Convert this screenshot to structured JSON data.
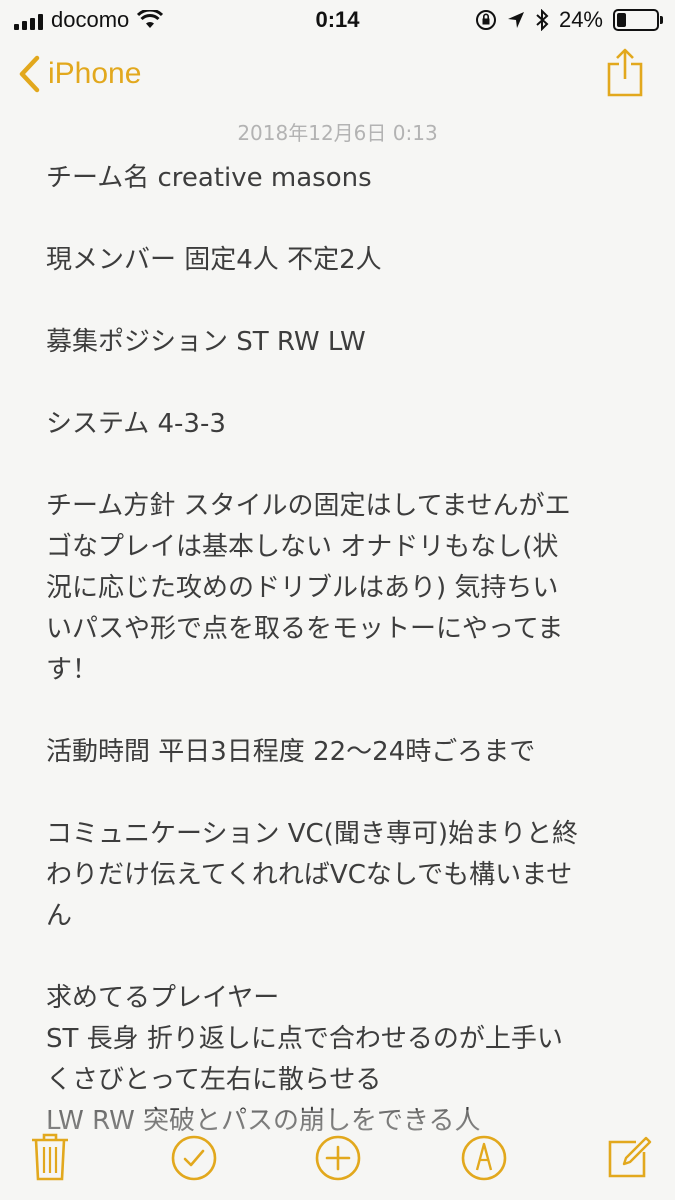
{
  "status_bar": {
    "carrier": "docomo",
    "time": "0:14",
    "battery_percent": "24%",
    "battery_level": 0.24
  },
  "nav": {
    "back_label": "iPhone"
  },
  "note": {
    "date": "2018年12月6日 0:13",
    "paragraphs": [
      [
        "チーム名 creative masons"
      ],
      [
        "現メンバー 固定4人 不定2人"
      ],
      [
        "募集ポジション ST RW LW"
      ],
      [
        "システム 4-3-3"
      ],
      [
        "チーム方針 スタイルの固定はしてませんがエ",
        "ゴなプレイは基本しない オナドリもなし(状",
        "況に応じた攻めのドリブルはあり) 気持ちい",
        "いパスや形で点を取るをモットーにやってま",
        "す！"
      ],
      [
        "活動時間 平日3日程度 22〜24時ごろまで"
      ],
      [
        "コミュニケーション VC(聞き専可)始まりと終",
        "わりだけ伝えてくれればVCなしでも構いませ",
        "ん"
      ],
      [
        "求めてるプレイヤー",
        "ST 長身 折り返しに点で合わせるのが上手い",
        "くさびとって左右に散らせる",
        "LW RW 突破とパスの崩しをできる人"
      ]
    ]
  },
  "toolbar": {
    "icons": [
      "trash-icon",
      "checklist-icon",
      "add-icon",
      "markup-icon",
      "compose-icon"
    ]
  },
  "colors": {
    "accent": "#e2a81d",
    "background": "#f6f6f4",
    "text": "#3d3d3d",
    "date": "#b3b3b3"
  }
}
